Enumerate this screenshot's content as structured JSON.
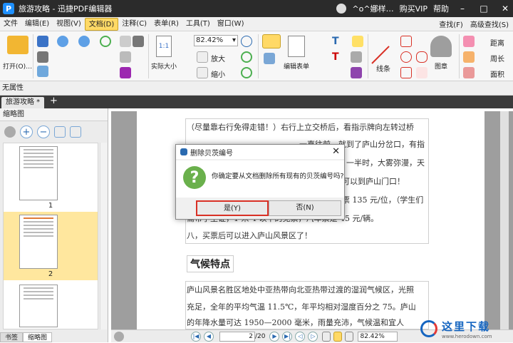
{
  "window": {
    "title": "旅游攻略 - 迅捷PDF编辑器",
    "user": "^o^娜样…",
    "vip": "购买VIP",
    "help": "帮助"
  },
  "menu": {
    "items": [
      "文件",
      "编辑(E)",
      "视图(V)",
      "文档(D)",
      "注释(C)",
      "表单(R)",
      "工具(T)",
      "窗口(W)"
    ],
    "active_index": 3,
    "find": "查找(F)",
    "adv_find": "高级查找(S)"
  },
  "ribbon": {
    "open": "打开(O)…",
    "actual_size": "实际大小",
    "zoom": "82.42%",
    "zoom_in": "放大",
    "zoom_out": "缩小",
    "edit_form": "编辑表单",
    "line": "线条",
    "stamp": "图章",
    "distance": "距离",
    "perimeter": "周长",
    "area": "面积"
  },
  "props": {
    "label": "无属性"
  },
  "tab": {
    "name": "旅游攻略 *",
    "add": "+"
  },
  "panel": {
    "title": "缩略图",
    "pages": [
      "1",
      "2"
    ],
    "tabs": [
      "书签",
      "缩略图"
    ]
  },
  "doc": {
    "para1": "（尽量靠右行免得走错！）右行上立交桥后，看指示牌向左转过桥",
    "para1b": "一直往前，就到了庐山分岔口，有指示牌的提",
    "para1c": "一半时，大雾弥漫，天",
    "para1d": "可以到庐山门口！",
    "para1e": "票 135 元/位，（学生们",
    "para1f": "需带学生证，1 米 4 以下的免票，汽车票是 45 元/辆。",
    "para2": "八，买票后可以进入庐山风景区了！",
    "heading": "气候特点",
    "para3a": "庐山风景名胜区地处中亚热带向北亚热带过渡的湿润气候区，光照",
    "para3b": "充足，全年的平均气温 11.5℃，年平均相对湿度百分之 75。庐山",
    "para3c": "的年降水量可达 1950—2000 毫米，雨量充沛，气候温和宜人"
  },
  "status": {
    "page": "2",
    "total": "/20",
    "zoom": "82.42%"
  },
  "dialog": {
    "title": "删除贝茨编号",
    "message": "你确定要从文档删除所有现有的贝茨编号吗?",
    "yes": "是(Y)",
    "no": "否(N)"
  },
  "watermark": {
    "text": "这里下载",
    "url": "www.herodown.com"
  }
}
